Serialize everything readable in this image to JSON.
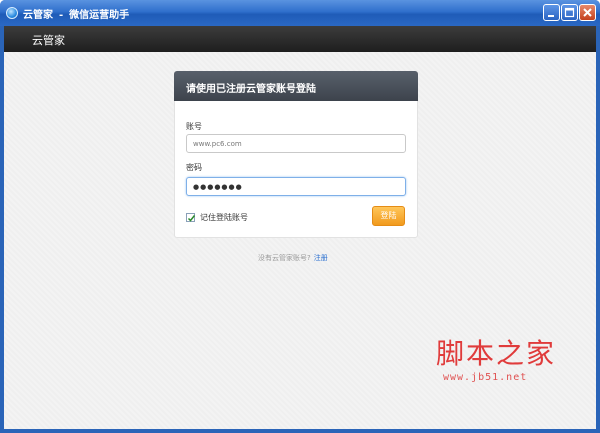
{
  "window": {
    "title_app": "云管家",
    "title_sep": "-",
    "title_sub": "微信运营助手"
  },
  "header": {
    "brand": "云管家"
  },
  "login": {
    "heading": "请使用已注册云管家账号登陆",
    "account_label": "账号",
    "account_value": "www.pc6.com",
    "password_label": "密码",
    "password_value": "●●●●●●●",
    "remember_label": "记住登陆账号",
    "remember_checked": true,
    "submit_label": "登陆"
  },
  "footer": {
    "no_account_text": "没有云管家账号?",
    "register_label": "注册"
  },
  "watermark": {
    "text": "脚本之家",
    "url": "www.jb51.net"
  },
  "colors": {
    "titlebar": "#2a68c4",
    "header_bg": "#2a2a2a",
    "card_header": "#4a5059",
    "submit": "#f5a623",
    "link": "#2a6fd0",
    "watermark": "#e03b3b"
  }
}
